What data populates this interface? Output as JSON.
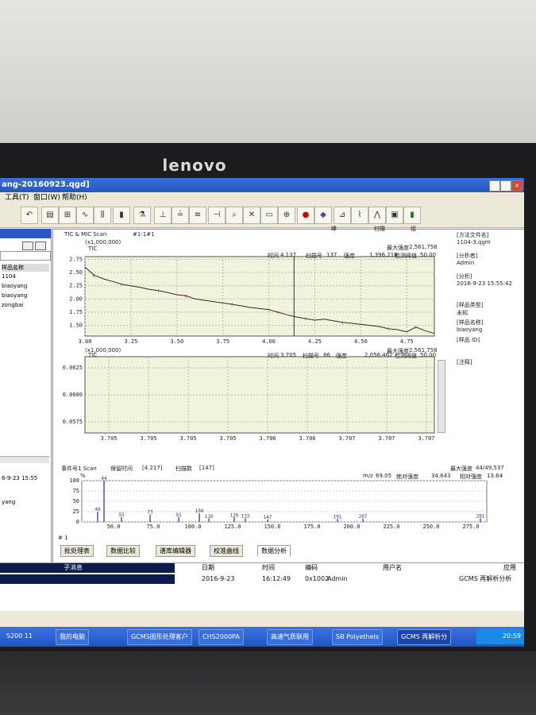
{
  "monitor": {
    "brand": "lenovo"
  },
  "window": {
    "title": "ang-20160923.qgd]",
    "menu": [
      "工具(T)",
      "窗口(W)",
      "帮助(H)"
    ]
  },
  "left_panel": {
    "header": "样品名称",
    "rows": [
      "1104",
      "biaoyang",
      "biaoyang",
      "zongbai"
    ],
    "info_date": "6-9-23 15:55",
    "info_name": "yang"
  },
  "tic_panel": {
    "title": "TIC & MIC Scan",
    "tag": "#1-1#1",
    "nav": [
      "峰",
      "扫描",
      "组"
    ],
    "scale": "(x1,000,000)",
    "series_label": "TIC",
    "readout": {
      "time_label": "时间",
      "time": "4.137",
      "scan_label": "扫描号",
      "scan": "137",
      "intensity_label": "强度",
      "intensity": "1,396,218",
      "max_label": "最大强度",
      "max": "2,561,758",
      "threshold_label": "检测阈值",
      "threshold": "50.00"
    }
  },
  "mic_panel": {
    "scale": "(x1,000,000)",
    "series_label": "TIC",
    "readout": {
      "time_label": "时间",
      "time": "3.705",
      "scan_label": "扫描号",
      "scan": "86",
      "intensity_label": "强度",
      "intensity": "2,056,462",
      "max_label": "最大强度",
      "max": "2,561,758",
      "threshold_label": "检测阈值",
      "threshold": "50.00"
    }
  },
  "info_panel": {
    "method_label": "[方法文件名]",
    "method": "1104-3.qgm",
    "analyst_label": "[分析者]",
    "analyst": "Admin",
    "date_label": "[分析]",
    "date": "2016-9-23 15:55:42",
    "type_label": "[样品类型]",
    "type": "未知",
    "name_label": "[样品名称]",
    "name": "biaoyang",
    "id_label": "[样品 ID]",
    "note_label": "[注释]"
  },
  "spectrum_panel": {
    "title": "事件号1 Scan",
    "rt_label": "保留时间",
    "rt": "[4.217]",
    "scan_label": "扫描数",
    "scan": "[147]",
    "max_label": "最大强度",
    "max": "44/49,537",
    "mz_label": "m/z",
    "mz": "69.05",
    "abs_label": "绝对强度",
    "abs": "34,643",
    "rel_label": "相对强度",
    "rel": "13.64",
    "percent_label": "%"
  },
  "tabs": [
    "批处理表",
    "数据比较",
    "谱库编辑器",
    "校准曲线",
    "数据分析"
  ],
  "bottom_label": "# 1",
  "table": {
    "headers": [
      "子消息",
      "日期",
      "时间",
      "编码",
      "用户名",
      "应用"
    ],
    "row": [
      "",
      "2016-9-23",
      "16:12:49",
      "0x1002",
      "Admin",
      "GCMS 再解析分析"
    ]
  },
  "taskbar": {
    "items": [
      "S200 11",
      "我的电脑",
      "GCMS图形处理客户",
      "CHS2000PA",
      "高速气质联用",
      "SB PolyetheIs",
      "GCMS 再解析分"
    ],
    "clock": "20:59"
  },
  "chart_data": [
    {
      "type": "line",
      "name": "TIC",
      "xlim": [
        3.0,
        4.9
      ],
      "ylim": [
        1.3,
        2.8
      ],
      "xticks": [
        "3.00",
        "3.25",
        "3.50",
        "3.75",
        "4.00",
        "4.25",
        "4.50",
        "4.75"
      ],
      "yticks": [
        "1.50",
        "1.75",
        "2.00",
        "2.25",
        "2.50",
        "2.75"
      ],
      "x": [
        3.0,
        3.05,
        3.1,
        3.15,
        3.2,
        3.3,
        3.35,
        3.4,
        3.45,
        3.5,
        3.55,
        3.6,
        3.7,
        3.8,
        3.9,
        4.0,
        4.05,
        4.1,
        4.15,
        4.2,
        4.25,
        4.3,
        4.4,
        4.5,
        4.6,
        4.65,
        4.7,
        4.75,
        4.8,
        4.85,
        4.9
      ],
      "y": [
        2.6,
        2.45,
        2.38,
        2.33,
        2.28,
        2.22,
        2.18,
        2.16,
        2.12,
        2.08,
        2.06,
        2.0,
        1.95,
        1.9,
        1.84,
        1.8,
        1.75,
        1.7,
        1.66,
        1.63,
        1.6,
        1.62,
        1.56,
        1.52,
        1.48,
        1.44,
        1.42,
        1.38,
        1.47,
        1.4,
        1.35
      ],
      "cursor_x": 4.137
    },
    {
      "type": "line",
      "name": "TIC",
      "xticks": [
        "3.705",
        "3.705",
        "3.705",
        "3.705",
        "3.706",
        "3.706",
        "3.707",
        "3.707",
        "3.707"
      ],
      "yticks": [
        "0.0575",
        "0.0600",
        "0.0625"
      ]
    },
    {
      "type": "bar",
      "name": "mass spectrum",
      "xlim": [
        30,
        285
      ],
      "ylim": [
        0,
        100
      ],
      "xticks": [
        "50.0",
        "75.0",
        "100.0",
        "125.0",
        "150.0",
        "175.0",
        "200.0",
        "225.0",
        "250.0",
        "275.0"
      ],
      "yticks": [
        "0",
        "25",
        "50",
        "75",
        "100"
      ],
      "x": [
        40,
        44,
        55,
        73,
        91,
        104,
        110,
        126,
        133,
        147,
        191,
        207,
        281
      ],
      "y": [
        25,
        100,
        12,
        18,
        12,
        21,
        8,
        11,
        9,
        6,
        7,
        8,
        9
      ],
      "labels": [
        "40",
        "44",
        "55",
        "73",
        "91",
        "104",
        "110",
        "126",
        "133",
        "147",
        "191",
        "207",
        "281"
      ]
    }
  ]
}
